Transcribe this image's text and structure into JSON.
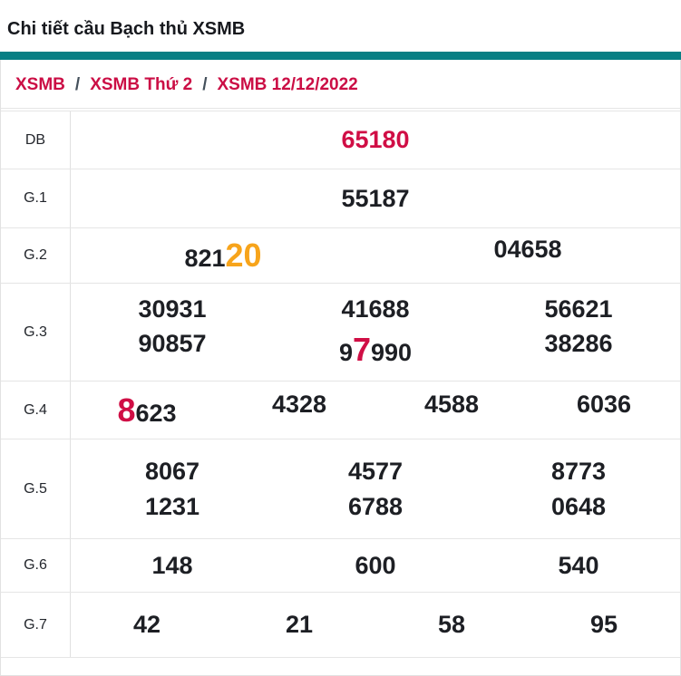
{
  "page": {
    "title": "Chi tiết cầu Bạch thủ XSMB"
  },
  "breadcrumb": {
    "items": [
      "XSMB",
      "XSMB Thứ 2",
      "XSMB 12/12/2022"
    ],
    "separator": "/"
  },
  "colors": {
    "accent_teal": "#087f84",
    "highlight_red": "#d00e45",
    "highlight_orange": "#f7a41b",
    "breadcrumb_red": "#cb0e45",
    "number_black": "#1d1f24",
    "border_gray": "#e5e5e5"
  },
  "table": {
    "rows": [
      {
        "label": "DB",
        "lines": [
          [
            {
              "segments": [
                {
                  "t": "65180",
                  "hl": "red"
                }
              ]
            }
          ]
        ]
      },
      {
        "label": "G.1",
        "lines": [
          [
            {
              "segments": [
                {
                  "t": "55187"
                }
              ]
            }
          ]
        ]
      },
      {
        "label": "G.2",
        "lines": [
          [
            {
              "segments": [
                {
                  "t": "821"
                },
                {
                  "t": "20",
                  "hl": "orange-big"
                }
              ]
            },
            {
              "segments": [
                {
                  "t": "04658"
                }
              ]
            }
          ]
        ]
      },
      {
        "label": "G.3",
        "lines": [
          [
            {
              "segments": [
                {
                  "t": "30931"
                }
              ]
            },
            {
              "segments": [
                {
                  "t": "41688"
                }
              ]
            },
            {
              "segments": [
                {
                  "t": "56621"
                }
              ]
            }
          ],
          [
            {
              "segments": [
                {
                  "t": "90857"
                }
              ]
            },
            {
              "segments": [
                {
                  "t": "9"
                },
                {
                  "t": "7",
                  "hl": "red-big"
                },
                {
                  "t": "990"
                }
              ]
            },
            {
              "segments": [
                {
                  "t": "38286"
                }
              ]
            }
          ]
        ]
      },
      {
        "label": "G.4",
        "lines": [
          [
            {
              "segments": [
                {
                  "t": "8",
                  "hl": "red-big"
                },
                {
                  "t": "623"
                }
              ]
            },
            {
              "segments": [
                {
                  "t": "4328"
                }
              ]
            },
            {
              "segments": [
                {
                  "t": "4588"
                }
              ]
            },
            {
              "segments": [
                {
                  "t": "6036"
                }
              ]
            }
          ]
        ]
      },
      {
        "label": "G.5",
        "lines": [
          [
            {
              "segments": [
                {
                  "t": "8067"
                }
              ]
            },
            {
              "segments": [
                {
                  "t": "4577"
                }
              ]
            },
            {
              "segments": [
                {
                  "t": "8773"
                }
              ]
            }
          ],
          [
            {
              "segments": [
                {
                  "t": "1231"
                }
              ]
            },
            {
              "segments": [
                {
                  "t": "6788"
                }
              ]
            },
            {
              "segments": [
                {
                  "t": "0648"
                }
              ]
            }
          ]
        ]
      },
      {
        "label": "G.6",
        "lines": [
          [
            {
              "segments": [
                {
                  "t": "148"
                }
              ]
            },
            {
              "segments": [
                {
                  "t": "600"
                }
              ]
            },
            {
              "segments": [
                {
                  "t": "540"
                }
              ]
            }
          ]
        ]
      },
      {
        "label": "G.7",
        "lines": [
          [
            {
              "segments": [
                {
                  "t": "42"
                }
              ]
            },
            {
              "segments": [
                {
                  "t": "21"
                }
              ]
            },
            {
              "segments": [
                {
                  "t": "58"
                }
              ]
            },
            {
              "segments": [
                {
                  "t": "95"
                }
              ]
            }
          ]
        ]
      }
    ]
  }
}
